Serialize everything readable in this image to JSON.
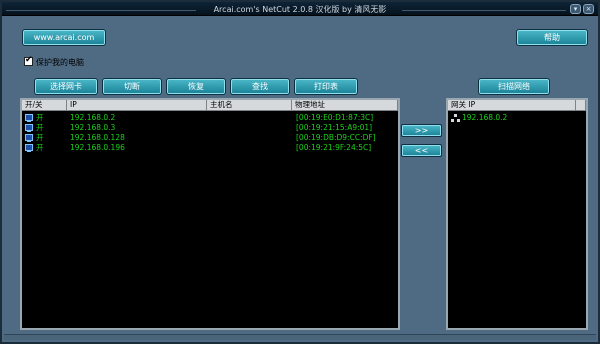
{
  "window": {
    "title": "Arcai.com's NetCut 2.0.8 汉化版 by 清风无影"
  },
  "toolbar": {
    "website_label": "www.arcai.com",
    "help_label": "帮助",
    "protect_label": "保护我的电脑",
    "protect_checked": true,
    "select_nic_label": "选择网卡",
    "cut_label": "切断",
    "restore_label": "恢复",
    "find_label": "查找",
    "print_label": "打印表",
    "scan_label": "扫描网络"
  },
  "host_table": {
    "columns": [
      "开/关",
      "IP",
      "主机名",
      "物理地址"
    ],
    "rows": [
      {
        "state": "开",
        "ip": "192.168.0.2",
        "hostname": "",
        "mac": "[00:19:E0:D1:87:3C]"
      },
      {
        "state": "开",
        "ip": "192.168.0.3",
        "hostname": "",
        "mac": "[00:19:21:15:A9:01]"
      },
      {
        "state": "开",
        "ip": "192.168.0.128",
        "hostname": "",
        "mac": "[00:19:DB:D9:CC:DF]"
      },
      {
        "state": "开",
        "ip": "192.168.0.196",
        "hostname": "",
        "mac": "[00:19:21:9F:24:5C]"
      }
    ]
  },
  "transfer": {
    "add_label": ">>",
    "remove_label": "<<"
  },
  "gateway_table": {
    "column": "网关 IP",
    "rows": [
      {
        "ip": "192.168.0.2"
      }
    ]
  },
  "colors": {
    "text_green": "#1bd21b",
    "button_teal": "#1a8196",
    "window_bg": "#4f6b83"
  },
  "icons": {
    "host_row": "computer-icon",
    "gateway_row": "network-gateway-icon"
  }
}
